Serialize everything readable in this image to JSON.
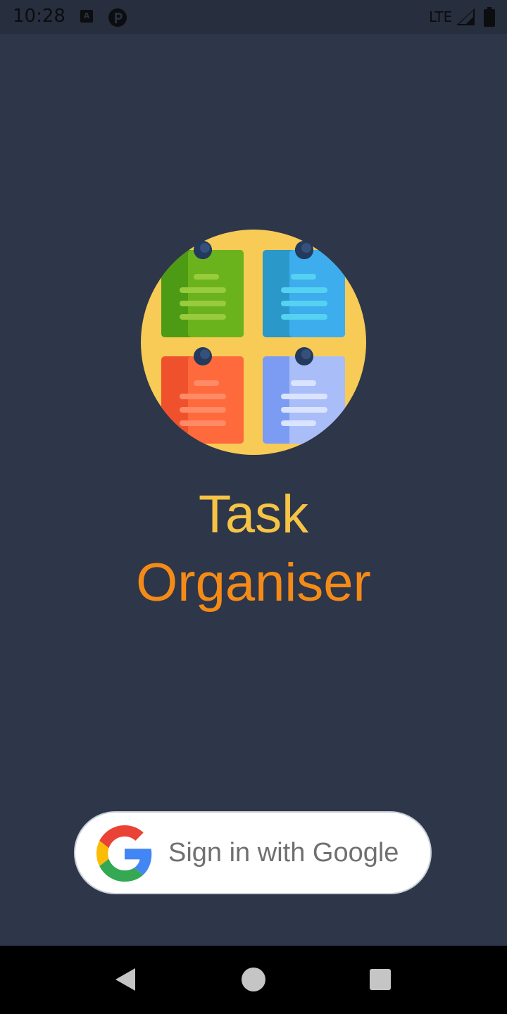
{
  "status_bar": {
    "time": "10:28",
    "notification_icons": [
      "a-notification-icon",
      "p-notification-icon"
    ],
    "network": "LTE",
    "signal_icon": "signal-icon",
    "battery_icon": "battery-icon"
  },
  "app": {
    "title_line_1": "Task",
    "title_line_2": "Organiser",
    "logo_icon": "sticky-notes-icon"
  },
  "sign_in": {
    "label": "Sign in with Google",
    "icon": "google-g-icon"
  },
  "nav_bar": {
    "back_icon": "back-triangle-icon",
    "home_icon": "home-circle-icon",
    "recents_icon": "recents-square-icon"
  },
  "colors": {
    "background": "#2e3649",
    "status_bar": "#272e3d",
    "title_task": "#f6c445",
    "title_organiser": "#f58b17",
    "logo_circle": "#f8cb57",
    "button_background": "#ffffff",
    "button_text": "#707070"
  }
}
